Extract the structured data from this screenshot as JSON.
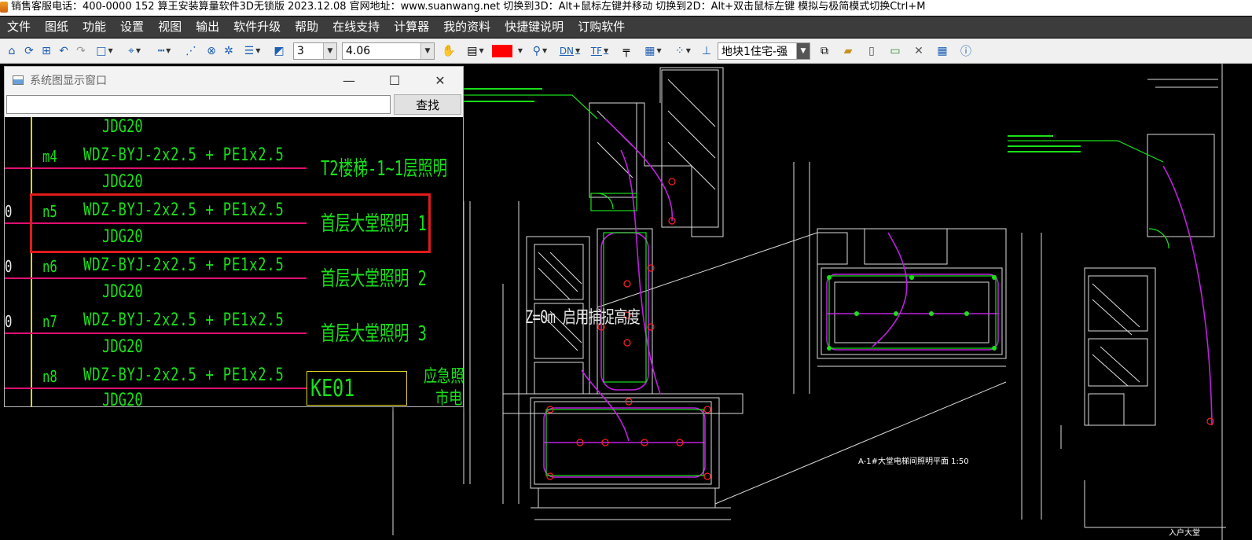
{
  "title_bar": {
    "text": "销售客服电话：400-0000 152   算王安装算量软件3D无锁版 2023.12.08 官网地址：www.suanwang.net  切换到3D：Alt+鼠标左键并移动 切换到2D：Alt+双击鼠标左键 模拟与极简模式切换Ctrl+M"
  },
  "menu": [
    "文件",
    "图纸",
    "功能",
    "设置",
    "视图",
    "输出",
    "软件升级",
    "帮助",
    "在线支持",
    "计算器",
    "我的资料",
    "快捷键说明",
    "订购软件"
  ],
  "toolbar": {
    "layer_index": "3",
    "scale_value": "4.06",
    "current_color": "#ff0000",
    "dn_label": "DN",
    "tf_label": "TF",
    "current_block": "地块1住宅-强"
  },
  "cad": {
    "z_label": "Z=0m  启用捕捉高度",
    "plan_title": "A-1#大堂电梯间照明平面 1:50",
    "room_label": "入户大堂"
  },
  "system_window": {
    "title": "系统图显示窗口",
    "search_placeholder": "",
    "search_button": "查找",
    "rows": [
      {
        "prefix": "",
        "id": "m4",
        "spec": "WDZ-BYJ-2x2.5 + PE1x2.5",
        "conduit": "JDG20",
        "desc": "T2楼梯-1~1层照明"
      },
      {
        "prefix": "0",
        "id": "n5",
        "spec": "WDZ-BYJ-2x2.5 + PE1x2.5",
        "conduit": "JDG20",
        "desc": "首层大堂照明 1"
      },
      {
        "prefix": "0",
        "id": "n6",
        "spec": "WDZ-BYJ-2x2.5 + PE1x2.5",
        "conduit": "JDG20",
        "desc": "首层大堂照明 2"
      },
      {
        "prefix": "0",
        "id": "n7",
        "spec": "WDZ-BYJ-2x2.5 + PE1x2.5",
        "conduit": "JDG20",
        "desc": "首层大堂照明 3"
      },
      {
        "prefix": "",
        "id": "n8",
        "spec": "WDZ-BYJ-2x2.5 + PE1x2.5",
        "conduit": "JDG20",
        "desc": ""
      }
    ],
    "top_conduit": "JDG20",
    "ke_box": "KE01",
    "emergency_text": [
      "应急照明",
      "市电"
    ]
  }
}
